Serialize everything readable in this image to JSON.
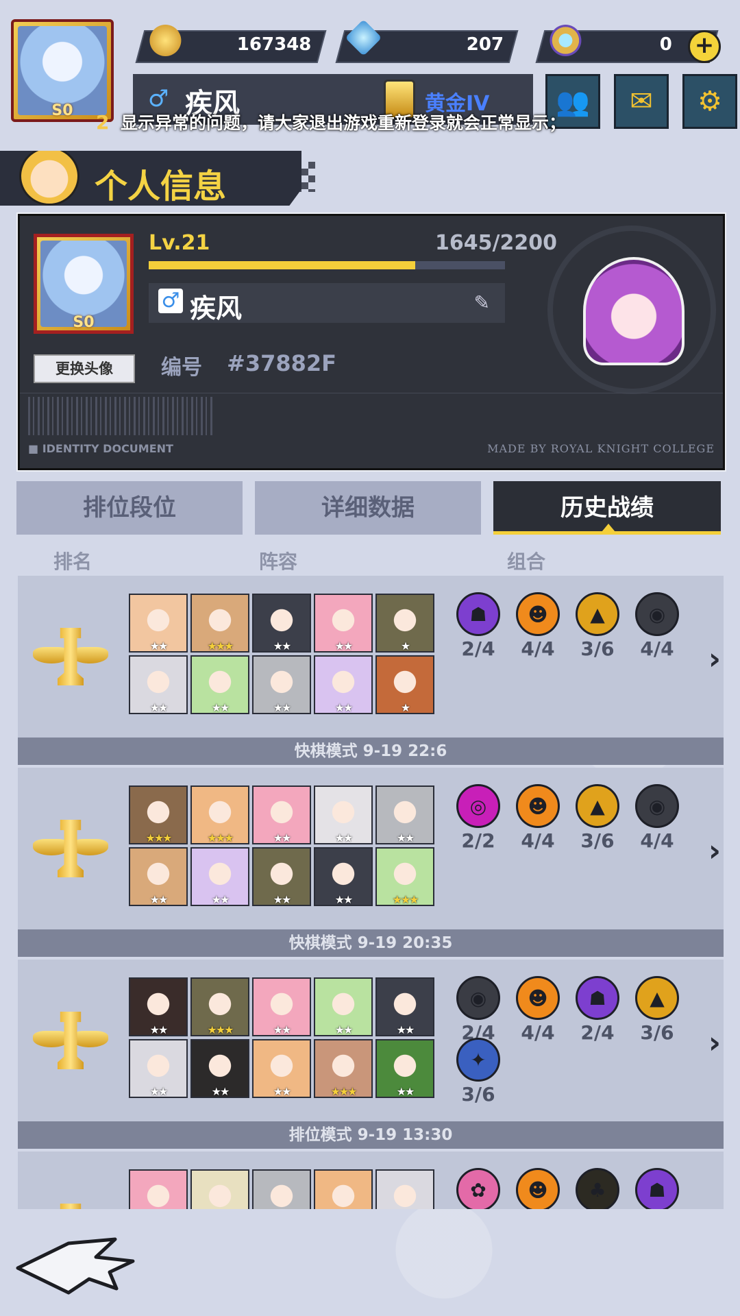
{
  "topbar": {
    "avatar_badge": "S0",
    "currencies": [
      {
        "icon": "drum-coin-icon",
        "value": "167348"
      },
      {
        "icon": "diamond-icon",
        "value": "207"
      },
      {
        "icon": "token-ring-icon",
        "value": "0"
      }
    ],
    "gender_symbol": "♂",
    "player_name": "疾风",
    "rank": "黄金IV",
    "notice": "显示异常的问题，请大家退出游戏重新登录就会正常显示；",
    "notice_prefix": "2"
  },
  "section": {
    "title": "个人信息"
  },
  "profile": {
    "avatar_badge": "S0",
    "change_avatar": "更换头像",
    "level": "Lv.21",
    "exp": "1645/2200",
    "exp_progress": 0.748,
    "gender_symbol": "♂",
    "name": "疾风",
    "edit_glyph": "✎",
    "id_label": "编号",
    "id_value": "#37882F",
    "identity_text": "■ IDENTITY DOCUMENT",
    "made_by": "MADE BY ROYAL KNIGHT COLLEGE"
  },
  "tabs": [
    {
      "label": "排位段位",
      "active": false
    },
    {
      "label": "详细数据",
      "active": false
    },
    {
      "label": "历史战绩",
      "active": true
    }
  ],
  "columns": {
    "rank": "排名",
    "lineup": "阵容",
    "combo": "组合"
  },
  "matches": [
    {
      "footer": "快棋模式 9-19 22:6",
      "heroes": [
        {
          "stars": "★★",
          "color": "#f2c6a0"
        },
        {
          "stars": "★★★",
          "color": "#d9a97a"
        },
        {
          "stars": "★★",
          "color": "#3c3f4a"
        },
        {
          "stars": "★★",
          "color": "#f3a7bd"
        },
        {
          "stars": "★",
          "color": "#6f6a4c"
        },
        {
          "stars": "★★",
          "color": "#dad9e0"
        },
        {
          "stars": "★★",
          "color": "#b9e2a0"
        },
        {
          "stars": "★★",
          "color": "#b7b9be"
        },
        {
          "stars": "★★",
          "color": "#d9c3f0"
        },
        {
          "stars": "★",
          "color": "#c46a3a"
        }
      ],
      "traits": [
        {
          "count": "2/4",
          "color": "#7d3fcf",
          "glyph": "☗"
        },
        {
          "count": "4/4",
          "color": "#f08a1c",
          "glyph": "☻"
        },
        {
          "count": "3/6",
          "color": "#e0a21c",
          "glyph": "▲"
        },
        {
          "count": "4/4",
          "color": "#3a3c44",
          "glyph": "◉"
        }
      ]
    },
    {
      "footer": "快棋模式 9-19 20:35",
      "heroes": [
        {
          "stars": "★★★",
          "color": "#8a6a4c"
        },
        {
          "stars": "★★★",
          "color": "#f0b884"
        },
        {
          "stars": "★★",
          "color": "#f3a7bd"
        },
        {
          "stars": "★★",
          "color": "#e4e2e6"
        },
        {
          "stars": "★★",
          "color": "#b7b9be"
        },
        {
          "stars": "★★",
          "color": "#d9a97a"
        },
        {
          "stars": "★★",
          "color": "#d9c3f0"
        },
        {
          "stars": "★★",
          "color": "#6f6a4c"
        },
        {
          "stars": "★★",
          "color": "#3c3f4a"
        },
        {
          "stars": "★★★",
          "color": "#b9e2a0"
        }
      ],
      "traits": [
        {
          "count": "2/2",
          "color": "#c81fb8",
          "glyph": "◎"
        },
        {
          "count": "4/4",
          "color": "#f08a1c",
          "glyph": "☻"
        },
        {
          "count": "3/6",
          "color": "#e0a21c",
          "glyph": "▲"
        },
        {
          "count": "4/4",
          "color": "#3a3c44",
          "glyph": "◉"
        }
      ]
    },
    {
      "footer": "排位模式 9-19 13:30",
      "heroes": [
        {
          "stars": "★★",
          "color": "#3a2c2a"
        },
        {
          "stars": "★★★",
          "color": "#6f6a4c"
        },
        {
          "stars": "★★",
          "color": "#f3a7bd"
        },
        {
          "stars": "★★",
          "color": "#b9e2a0"
        },
        {
          "stars": "★★",
          "color": "#3c3f4a"
        },
        {
          "stars": "★★",
          "color": "#dad9e0"
        },
        {
          "stars": "★★",
          "color": "#2c2a2a"
        },
        {
          "stars": "★★",
          "color": "#f0b884"
        },
        {
          "stars": "★★★",
          "color": "#c9967a"
        },
        {
          "stars": "★★",
          "color": "#4c8a3c"
        }
      ],
      "traits": [
        {
          "count": "2/4",
          "color": "#3a3c44",
          "glyph": "◉"
        },
        {
          "count": "4/4",
          "color": "#f08a1c",
          "glyph": "☻"
        },
        {
          "count": "2/4",
          "color": "#7d3fcf",
          "glyph": "☗"
        },
        {
          "count": "3/6",
          "color": "#e0a21c",
          "glyph": "▲"
        },
        {
          "count": "3/6",
          "color": "#3a60c0",
          "glyph": "✦"
        }
      ]
    },
    {
      "footer": "",
      "heroes": [
        {
          "stars": "",
          "color": "#f3a7bd"
        },
        {
          "stars": "",
          "color": "#e8e0c0"
        },
        {
          "stars": "",
          "color": "#b7b9be"
        },
        {
          "stars": "",
          "color": "#f0b884"
        },
        {
          "stars": "",
          "color": "#dad9e0"
        }
      ],
      "traits": [
        {
          "count": "",
          "color": "#e36aa8",
          "glyph": "✿"
        },
        {
          "count": "",
          "color": "#f08a1c",
          "glyph": "☻"
        },
        {
          "count": "",
          "color": "#2c2a22",
          "glyph": "♣"
        },
        {
          "count": "",
          "color": "#7d3fcf",
          "glyph": "☗"
        }
      ]
    }
  ],
  "back_label": "back-arrow-icon"
}
